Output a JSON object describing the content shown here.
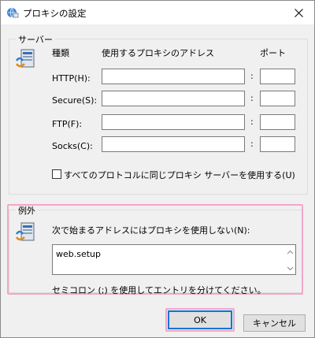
{
  "window": {
    "title": "プロキシの設定",
    "close_icon": "close-icon"
  },
  "servers": {
    "legend": "サーバー",
    "col_type": "種類",
    "col_address": "使用するプロキシのアドレス",
    "col_port": "ポート",
    "rows": [
      {
        "label": "HTTP(H):",
        "address": "",
        "port": ""
      },
      {
        "label": "Secure(S):",
        "address": "",
        "port": ""
      },
      {
        "label": "FTP(F):",
        "address": "",
        "port": ""
      },
      {
        "label": "Socks(C):",
        "address": "",
        "port": ""
      }
    ],
    "same_proxy_label": "すべてのプロトコルに同じプロキシ サーバーを使用する(U)",
    "same_proxy_checked": false
  },
  "exceptions": {
    "legend": "例外",
    "description": "次で始まるアドレスにはプロキシを使用しない(N):",
    "value": "web.setup",
    "note": "セミコロン (;) を使用してエントリを分けてください。"
  },
  "buttons": {
    "ok": "OK",
    "cancel": "キャンセル"
  },
  "colors": {
    "highlight": "#f2a7c8",
    "focus": "#0078d7",
    "face": "#f0f0f0"
  }
}
